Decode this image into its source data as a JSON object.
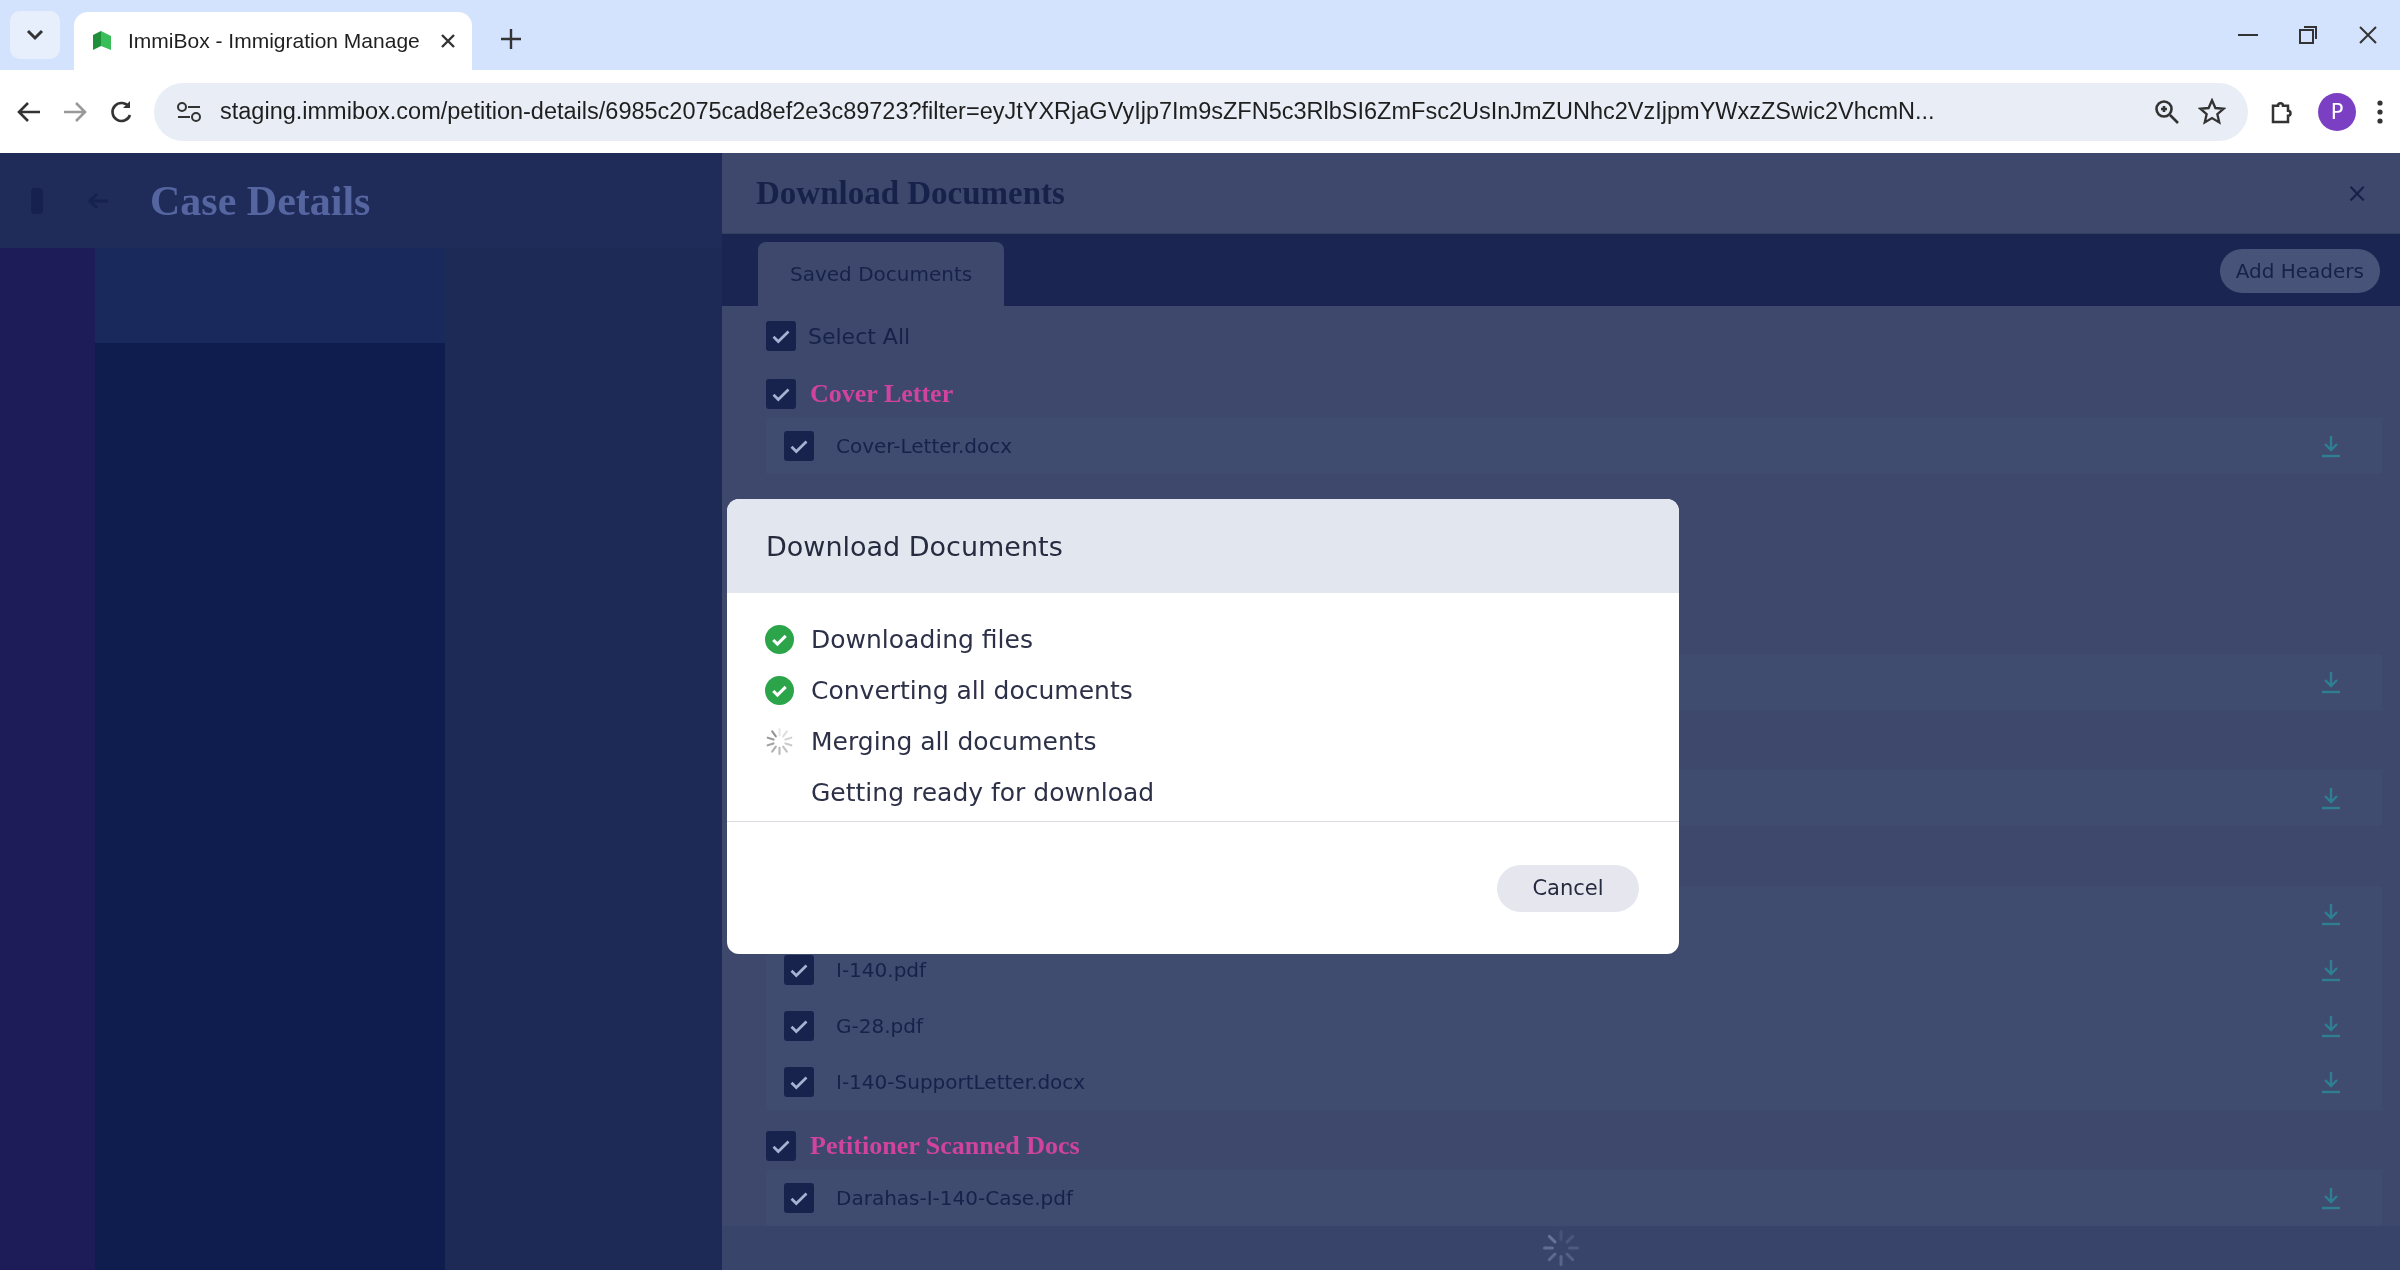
{
  "browser": {
    "tab_title": "ImmiBox - Immigration Manage",
    "url": "staging.immibox.com/petition-details/6985c2075cad8ef2e3c89723?filter=eyJtYXRjaGVyIjp7Im9sZFN5c3RlbSI6ZmFsc2UsInJmZUNhc2VzIjpmYWxzZSwic2VhcmN...",
    "profile_initial": "P"
  },
  "page": {
    "title": "Case Details"
  },
  "panel": {
    "title": "Download Documents",
    "close": "×",
    "tabs": [
      {
        "label": "Saved Documents",
        "selected": true
      }
    ],
    "add_headers": "Add Headers",
    "select_all": {
      "label": "Select All",
      "checked": true
    },
    "groups": [
      {
        "title": "Cover Letter",
        "checked": true,
        "files": [
          {
            "name": "Cover-Letter.docx",
            "checked": true,
            "download": true
          }
        ]
      },
      {
        "files": [
          {
            "download": true
          }
        ]
      },
      {
        "files": [
          {
            "download": true
          }
        ]
      },
      {
        "files": [
          {
            "download": true
          },
          {
            "name": "I-140.pdf",
            "checked": true,
            "download": true
          },
          {
            "name": "G-28.pdf",
            "checked": true,
            "download": true
          },
          {
            "name": "I-140-SupportLetter.docx",
            "checked": true,
            "download": true
          }
        ]
      },
      {
        "title": "Petitioner Scanned Docs",
        "checked": true,
        "files": [
          {
            "name": "Darahas-I-140-Case.pdf",
            "checked": true,
            "download": true
          }
        ]
      }
    ]
  },
  "modal": {
    "title": "Download Documents",
    "steps": [
      {
        "label": "Downloading files",
        "kind": "done"
      },
      {
        "label": "Converting all documents",
        "kind": "done"
      },
      {
        "label": "Merging all documents",
        "kind": "active"
      },
      {
        "label": "Getting ready for download",
        "kind": "pending"
      }
    ],
    "cancel": "Cancel"
  }
}
